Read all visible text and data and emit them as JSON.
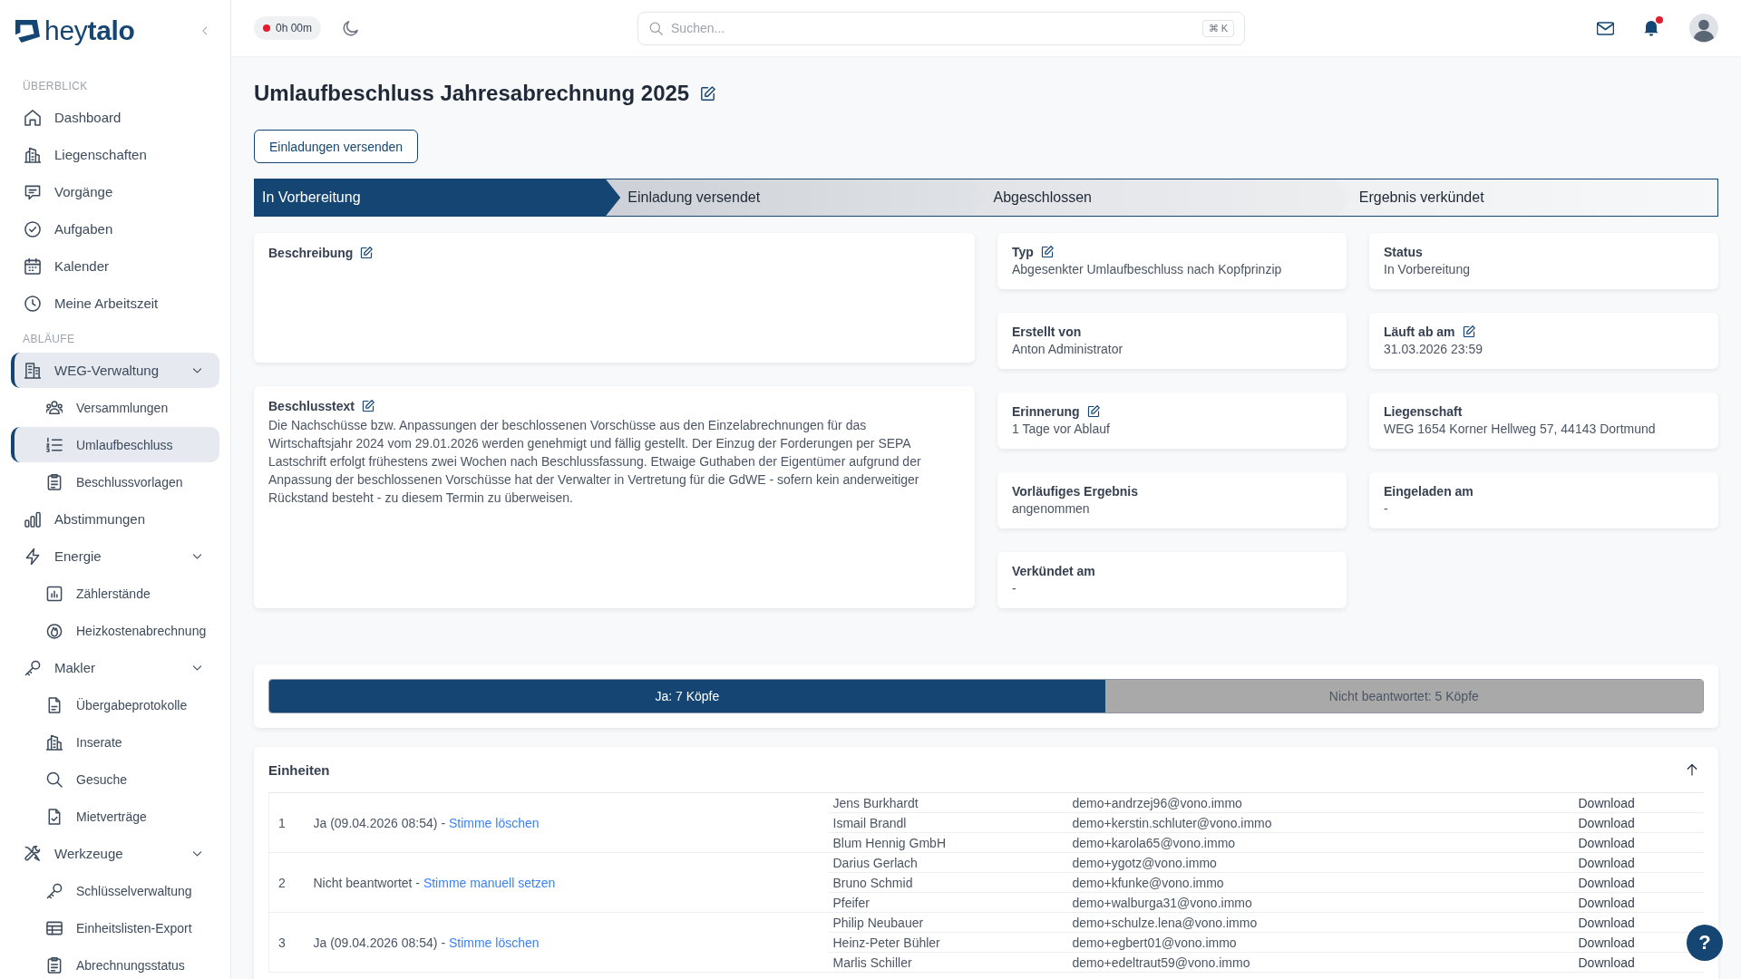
{
  "sidebar": {
    "logo": "hey**talo**",
    "sections": [
      {
        "title": "ÜBERBLICK",
        "items": [
          {
            "label": "Dashboard",
            "selected": false
          },
          {
            "label": "Liegenschaften",
            "selected": false
          },
          {
            "label": "Vorgänge",
            "selected": false
          },
          {
            "label": "Aufgaben",
            "selected": false
          },
          {
            "label": "Kalender",
            "selected": false
          },
          {
            "label": "Meine Arbeitszeit",
            "selected": false
          }
        ]
      },
      {
        "title": "ABLÄUFE",
        "items": [
          {
            "label": "WEG-Verwaltung",
            "selected": true,
            "expanded": true,
            "children": [
              {
                "label": "Versammlungen",
                "selected": false
              },
              {
                "label": "Umlaufbeschluss",
                "selected": true
              },
              {
                "label": "Beschlussvorlagen",
                "selected": false
              }
            ]
          },
          {
            "label": "Abstimmungen",
            "selected": false
          },
          {
            "label": "Energie",
            "selected": false,
            "expanded": true,
            "children": [
              {
                "label": "Zählerstände",
                "selected": false
              },
              {
                "label": "Heizkostenabrechnung",
                "selected": false
              }
            ]
          },
          {
            "label": "Makler",
            "selected": false,
            "expanded": true,
            "children": [
              {
                "label": "Übergabeprotokolle",
                "selected": false
              },
              {
                "label": "Inserate",
                "selected": false
              },
              {
                "label": "Gesuche",
                "selected": false
              },
              {
                "label": "Mietverträge",
                "selected": false
              }
            ]
          },
          {
            "label": "Werkzeuge",
            "selected": false,
            "expanded": true,
            "children": [
              {
                "label": "Schlüsselverwaltung",
                "selected": false
              },
              {
                "label": "Einheitslisten-Export",
                "selected": false
              },
              {
                "label": "Abrechnungsstatus",
                "selected": false
              }
            ]
          }
        ]
      }
    ]
  },
  "header": {
    "timer": "0h 00m",
    "search": {
      "placeholder": "Suchen...",
      "shortcut": "⌘ K"
    },
    "notifications": {
      "unread": true
    }
  },
  "page": {
    "title": "Umlaufbeschluss Jahresabrechnung 2025",
    "title_editable": true,
    "action": "Einladungen versenden",
    "stepper": [
      {
        "label": "In Vorbereitung",
        "selected": true
      },
      {
        "label": "Einladung versendet",
        "selected": false
      },
      {
        "label": "Abgeschlossen",
        "selected": false
      },
      {
        "label": "Ergebnis verkündet",
        "selected": false
      }
    ],
    "description": {
      "label": "Beschreibung",
      "editable": true
    },
    "resolution_text": {
      "label": "Beschlusstext",
      "editable": true,
      "text": "Die Nachschüsse bzw. Anpassungen der beschlossenen Vorschüsse aus den Einzelabrechnungen für das Wirtschaftsjahr 2024 vom 29.01.2026 werden genehmigt und fällig gestellt. Der Einzug der Forderungen per SEPA Lastschrift erfolgt frühestens zwei Wochen nach Beschlussfassung. Etwaige Guthaben der Eigentümer aufgrund der Anpassung der beschlossenen Vorschüsse hat der Verwalter in Vertretung für die GdWE - sofern kein anderweitiger Rückstand besteht - zu diesem Termin zu überweisen."
    },
    "details": [
      {
        "label": "Typ",
        "value": "Abgesenkter Umlaufbeschluss nach Kopfprinzip",
        "editable": true
      },
      {
        "label": "Status",
        "value": "In Vorbereitung",
        "editable": false
      },
      {
        "label": "Erstellt von",
        "value": "Anton Administrator",
        "editable": false
      },
      {
        "label": "Läuft ab am",
        "value": "31.03.2026 23:59",
        "editable": true
      },
      {
        "label": "Erinnerung",
        "value": "1 Tage vor Ablauf",
        "editable": true
      },
      {
        "label": "Liegenschaft",
        "value": "WEG 1654 Korner Hellweg 57, 44143 Dortmund",
        "editable": false
      },
      {
        "label": "Vorläufiges Ergebnis",
        "value": "angenommen",
        "editable": false
      },
      {
        "label": "Eingeladen am",
        "value": "-",
        "editable": false
      },
      {
        "label": "Verkündet am",
        "value": "-",
        "editable": false
      }
    ],
    "votes": [
      {
        "label": "Ja: 7 Köpfe",
        "level": 0.583,
        "color": "#154673"
      },
      {
        "label": "Nicht beantwortet: 5 Köpfe",
        "level": 0.417,
        "color": "#a9a9a9"
      }
    ],
    "units": {
      "title": "Einheiten",
      "rows": [
        {
          "number": "1",
          "status": "Ja (09.04.2026 08:54) -",
          "action": "Stimme löschen",
          "owners": [
            {
              "name": "Jens Burkhardt",
              "email": "demo+andrzej96@vono.immo",
              "file": "Download"
            },
            {
              "name": "Ismail Brandl",
              "email": "demo+kerstin.schluter@vono.immo",
              "file": "Download"
            },
            {
              "name": "Blum Hennig GmbH",
              "email": "demo+karola65@vono.immo",
              "file": "Download"
            }
          ]
        },
        {
          "number": "2",
          "status": "Nicht beantwortet -",
          "action": "Stimme manuell setzen",
          "owners": [
            {
              "name": "Darius Gerlach",
              "email": "demo+ygotz@vono.immo",
              "file": "Download"
            },
            {
              "name": "Bruno Schmid",
              "email": "demo+kfunke@vono.immo",
              "file": "Download"
            },
            {
              "name": "Pfeifer",
              "email": "demo+walburga31@vono.immo",
              "file": "Download"
            }
          ]
        },
        {
          "number": "3",
          "status": "Ja (09.04.2026 08:54) -",
          "action": "Stimme löschen",
          "owners": [
            {
              "name": "Philip Neubauer",
              "email": "demo+schulze.lena@vono.immo",
              "file": "Download"
            },
            {
              "name": "Heinz-Peter Bühler",
              "email": "demo+egbert01@vono.immo",
              "file": "Download"
            },
            {
              "name": "Marlis Schiller",
              "email": "demo+edeltraut59@vono.immo",
              "file": "Download"
            }
          ]
        }
      ]
    }
  },
  "help": "?"
}
